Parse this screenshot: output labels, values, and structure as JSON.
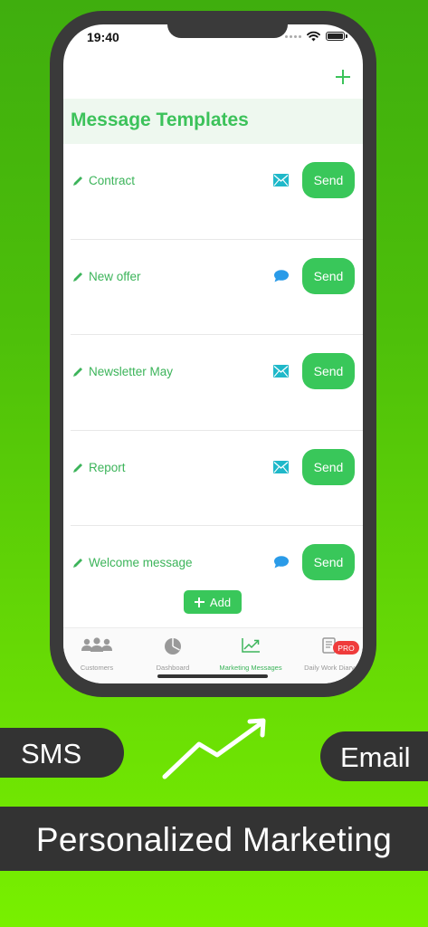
{
  "status_bar": {
    "time": "19:40"
  },
  "page": {
    "title": "Message Templates"
  },
  "templates": [
    {
      "label": "Contract",
      "type": "email-icon",
      "send_label": "Send"
    },
    {
      "label": "New offer",
      "type": "sms-bubble-icon",
      "send_label": "Send"
    },
    {
      "label": "Newsletter May",
      "type": "email-icon",
      "send_label": "Send"
    },
    {
      "label": "Report",
      "type": "email-icon",
      "send_label": "Send"
    },
    {
      "label": "Welcome message",
      "type": "sms-bubble-icon",
      "send_label": "Send"
    }
  ],
  "add_button": {
    "label": "Add"
  },
  "tabbar": {
    "tabs": [
      {
        "label": "Customers",
        "icon": "people-icon",
        "active": false
      },
      {
        "label": "Dashboard",
        "icon": "pie-chart-icon",
        "active": false
      },
      {
        "label": "Marketing Messages",
        "icon": "trend-chart-icon",
        "active": true
      },
      {
        "label": "Daily Work Diary",
        "icon": "book-icon",
        "active": false
      }
    ],
    "pro_badge": "PRO"
  },
  "marketing": {
    "sms_label": "SMS",
    "email_label": "Email",
    "banner": "Personalized Marketing"
  },
  "colors": {
    "accent": "#39c75a",
    "email_icon": "#1fb8c9",
    "sms_icon": "#2a9be8",
    "badge": "#ef3b3b",
    "dark_pill": "#333333"
  }
}
